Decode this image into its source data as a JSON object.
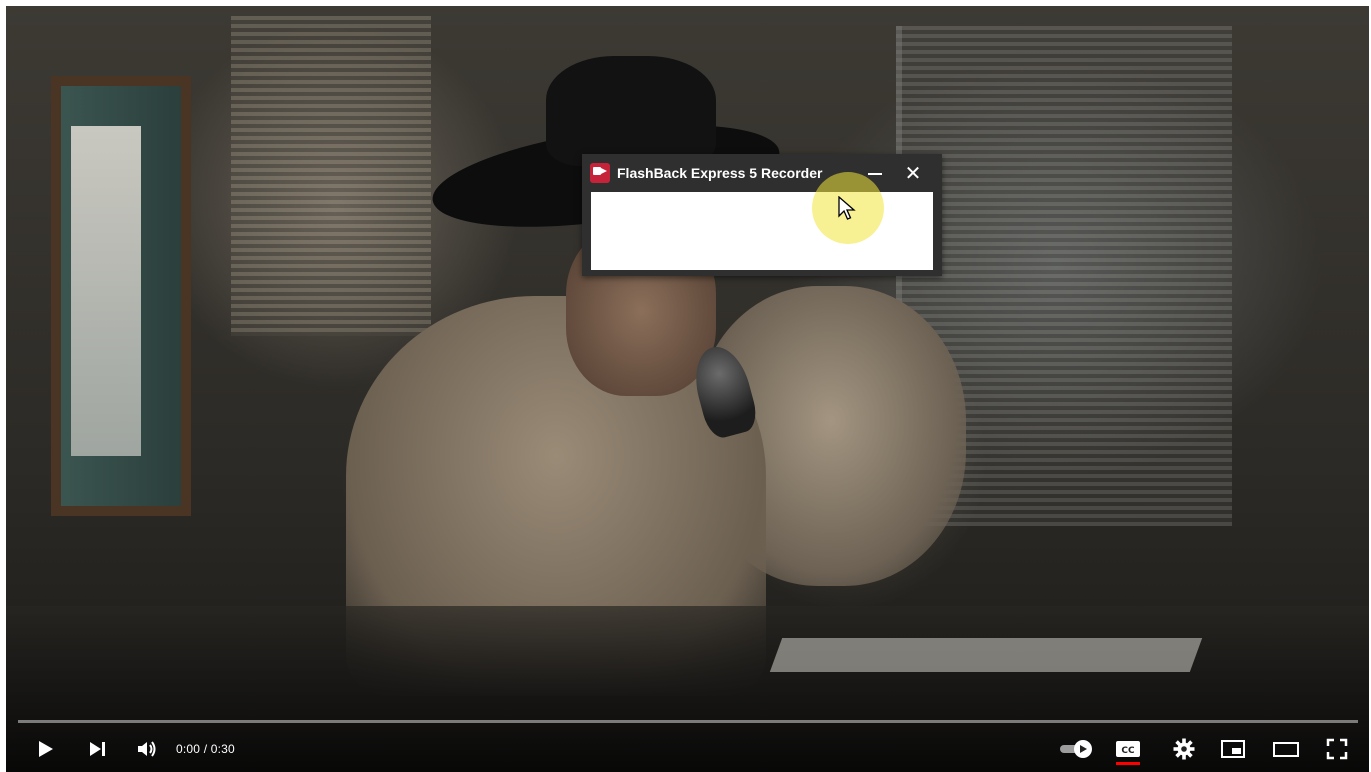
{
  "recorder": {
    "title": "FlashBack Express 5 Recorder",
    "close_glyph": "✕",
    "logo_icon": "flashback-logo-icon",
    "minimize_icon": "minimize-icon",
    "close_icon": "close-icon"
  },
  "player": {
    "time_current": "0:00",
    "time_separator": " / ",
    "time_total": "0:30",
    "progress_fraction": 0,
    "colors": {
      "progress_played": "#ff0000",
      "cc_active": "#ff0000",
      "recorder_title_bg": "#2f2f2f",
      "cursor_highlight": "#f0e63c"
    },
    "controls": {
      "play": "play-icon",
      "next": "next-icon",
      "volume": "volume-icon",
      "autoplay": "autoplay-toggle-icon",
      "captions": "captions-icon",
      "settings": "gear-icon",
      "miniplayer": "miniplayer-icon",
      "theater": "theater-mode-icon",
      "fullscreen": "fullscreen-icon"
    }
  }
}
